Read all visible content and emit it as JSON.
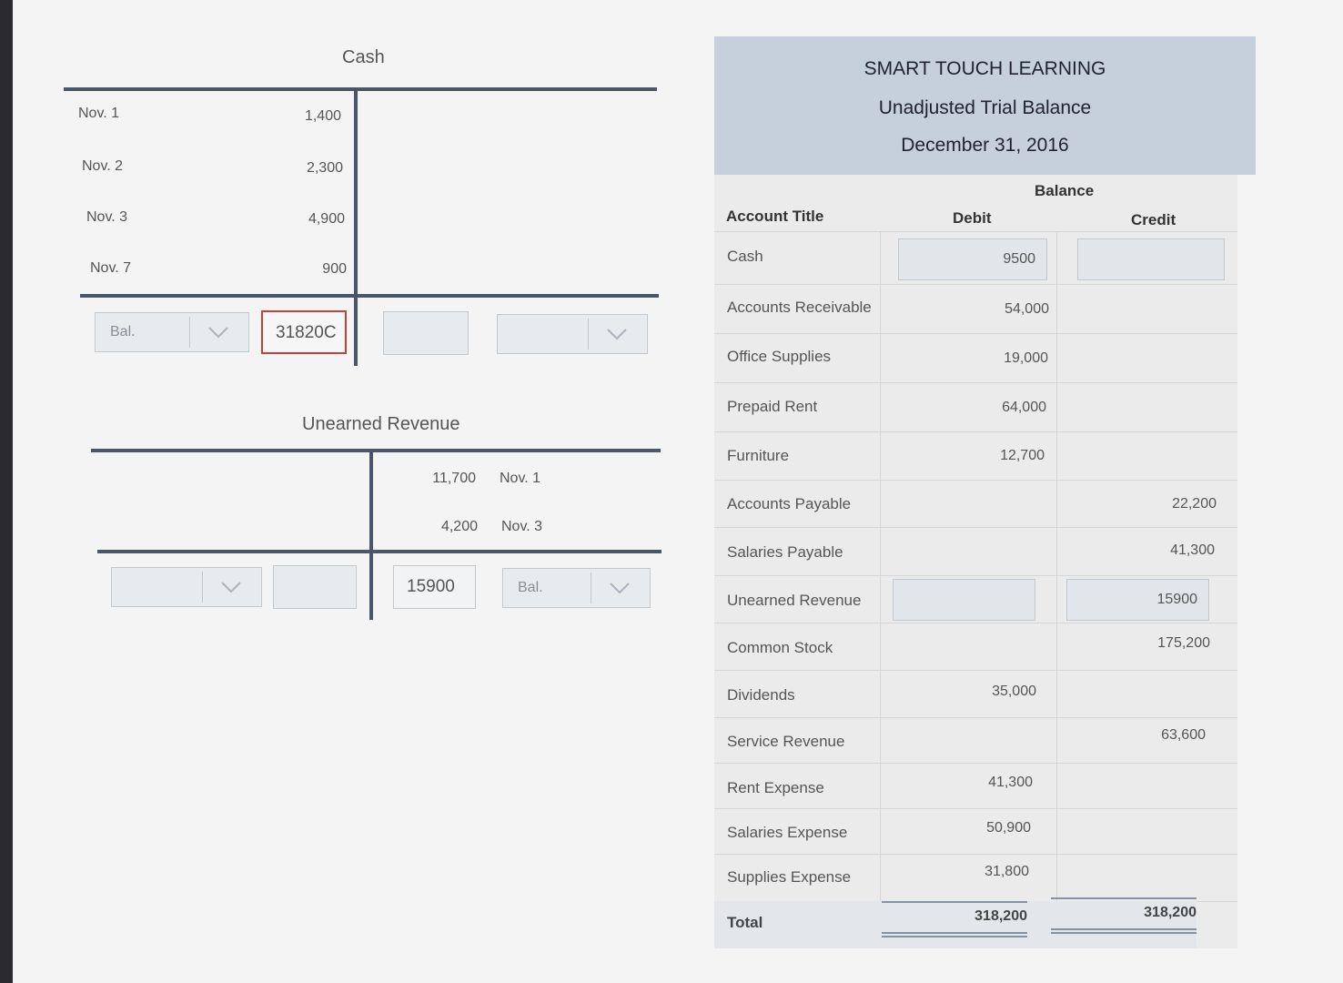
{
  "cash_account": {
    "title": "Cash",
    "debits": [
      {
        "date": "Nov. 1",
        "amount": "1,400"
      },
      {
        "date": "Nov. 2",
        "amount": "2,300"
      },
      {
        "date": "Nov. 3",
        "amount": "4,900"
      },
      {
        "date": "Nov. 7",
        "amount": "900"
      }
    ],
    "balance_select": "Bal.",
    "balance_input_left": "31820C",
    "balance_input_right": "",
    "balance_select_right": ""
  },
  "unearned_account": {
    "title": "Unearned Revenue",
    "credits": [
      {
        "amount": "11,700",
        "date": "Nov. 1"
      },
      {
        "amount": "4,200",
        "date": "Nov. 3"
      }
    ],
    "balance_select_left": "",
    "balance_input_left": "",
    "balance_input_right": "15900",
    "balance_select_right": "Bal."
  },
  "trial_balance": {
    "company": "SMART TOUCH LEARNING",
    "report": "Unadjusted Trial Balance",
    "date": "December 31, 2016",
    "balance_header": "Balance",
    "col_account": "Account Title",
    "col_debit": "Debit",
    "col_credit": "Credit",
    "rows": [
      {
        "title": "Cash",
        "debit": "9500",
        "credit": ""
      },
      {
        "title": "Accounts Receivable",
        "debit": "54,000",
        "credit": ""
      },
      {
        "title": "Office Supplies",
        "debit": "19,000",
        "credit": ""
      },
      {
        "title": "Prepaid Rent",
        "debit": "64,000",
        "credit": ""
      },
      {
        "title": "Furniture",
        "debit": "12,700",
        "credit": ""
      },
      {
        "title": "Accounts Payable",
        "debit": "",
        "credit": "22,200"
      },
      {
        "title": "Salaries Payable",
        "debit": "",
        "credit": "41,300"
      },
      {
        "title": "Unearned Revenue",
        "debit": "",
        "credit": "15900"
      },
      {
        "title": "Common Stock",
        "debit": "",
        "credit": "175,200"
      },
      {
        "title": "Dividends",
        "debit": "35,000",
        "credit": ""
      },
      {
        "title": "Service Revenue",
        "debit": "",
        "credit": "63,600"
      },
      {
        "title": "Rent Expense",
        "debit": "41,300",
        "credit": ""
      },
      {
        "title": "Salaries Expense",
        "debit": "50,900",
        "credit": ""
      },
      {
        "title": "Supplies Expense",
        "debit": "31,800",
        "credit": ""
      }
    ],
    "total_label": "Total",
    "total_debit": "318,200",
    "total_credit": "318,200"
  }
}
